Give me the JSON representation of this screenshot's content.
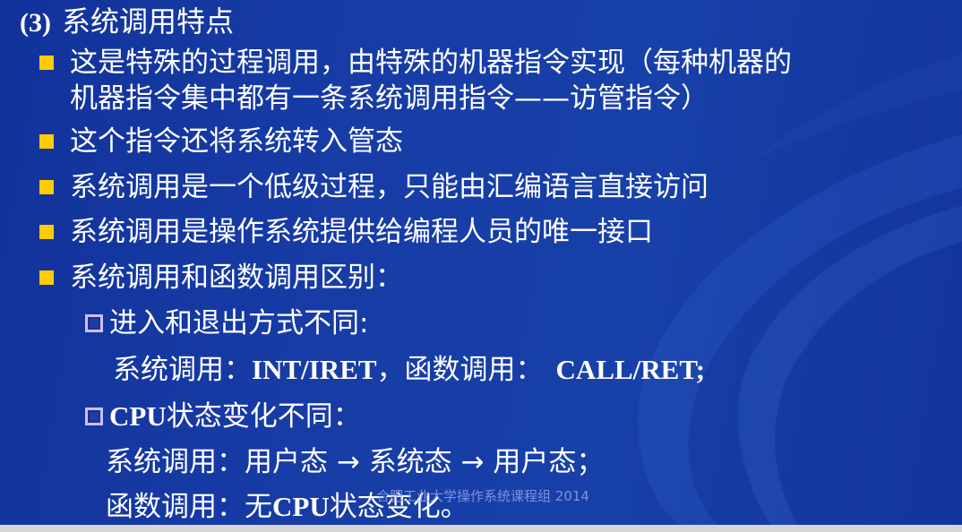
{
  "title": {
    "number": "(3)",
    "text": "系统调用特点"
  },
  "bullets": [
    {
      "line1": "这是特殊的过程调用，由特殊的机器指令实现（每种机器的",
      "line2": "机器指令集中都有一条系统调用指令——访管指令）"
    },
    {
      "line1": "这个指令还将系统转入管态"
    },
    {
      "line1": "系统调用是一个低级过程，只能由汇编语言直接访问"
    },
    {
      "line1": "系统调用是操作系统提供给编程人员的唯一接口"
    },
    {
      "line1": "系统调用和函数调用区别："
    }
  ],
  "sub_items": [
    {
      "heading": "进入和退出方式不同:",
      "detail": {
        "a_label": "系统调用：",
        "a_value": "INT/IRET",
        "sep": "，函数调用：",
        "b_value": "CALL/RET;"
      }
    },
    {
      "heading_latin": "CPU",
      "heading": "状态变化不同：",
      "detail1": {
        "label": "系统调用：",
        "s1": "用户态",
        "arrow1": " → ",
        "s2": "系统态",
        "arrow2": " → ",
        "s3": "用户态；"
      },
      "detail2": {
        "label": "函数调用：",
        "pre": "无",
        "latin": "CPU",
        "post": "状态变化。"
      }
    }
  ],
  "footer": "合肥工业大学操作系统课程组 2014",
  "colors": {
    "background": "#1740a8",
    "bullet": "#ffcc00",
    "text": "#ffffff",
    "footer": "#8fa0e8"
  }
}
